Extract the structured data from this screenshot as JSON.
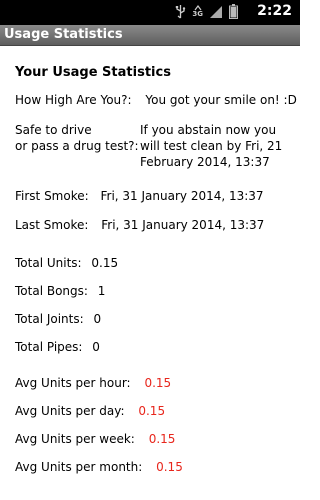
{
  "status_bar": {
    "time": "2:22",
    "network_label": "3G",
    "icons": [
      "usb-icon",
      "network-3g-icon",
      "signal-icon",
      "battery-icon"
    ]
  },
  "title_bar": {
    "title": "Usage Statistics"
  },
  "heading": "Your Usage Statistics",
  "how_high": {
    "label": "How High Are You?:",
    "value": "You got your smile on! :D"
  },
  "safe_to_drive": {
    "label_line1": "Safe to drive",
    "label_line2": "or pass a drug test?:",
    "value_line1": "If you abstain now you",
    "value_line2": "will test clean by Fri, 21",
    "value_line3": "February 2014, 13:37"
  },
  "first_smoke": {
    "label": "First Smoke:",
    "value": "Fri, 31 January 2014, 13:37"
  },
  "last_smoke": {
    "label": "Last Smoke:",
    "value": "Fri, 31 January 2014, 13:37"
  },
  "totals": {
    "units": {
      "label": "Total Units:",
      "value": "0.15"
    },
    "bongs": {
      "label": "Total Bongs:",
      "value": "1"
    },
    "joints": {
      "label": "Total Joints:",
      "value": "0"
    },
    "pipes": {
      "label": "Total Pipes:",
      "value": "0"
    }
  },
  "averages": {
    "hour": {
      "label": "Avg Units per hour:",
      "value": "0.15"
    },
    "day": {
      "label": "Avg Units per day:",
      "value": "0.15"
    },
    "week": {
      "label": "Avg Units per week:",
      "value": "0.15"
    },
    "month": {
      "label": "Avg Units per month:",
      "value": "0.15"
    }
  },
  "colors": {
    "accent_red": "#e8261c",
    "title_bar": "#6f6f6f",
    "status_bar": "#000000"
  }
}
